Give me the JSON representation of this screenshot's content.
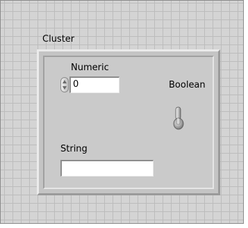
{
  "cluster": {
    "label": "Cluster",
    "numeric": {
      "label": "Numeric",
      "value": "0"
    },
    "boolean": {
      "label": "Boolean",
      "state": "off"
    },
    "string": {
      "label": "String",
      "value": ""
    }
  },
  "icons": {
    "increment_decrement": "increment-decrement-icon",
    "toggle_switch": "toggle-switch-icon"
  }
}
